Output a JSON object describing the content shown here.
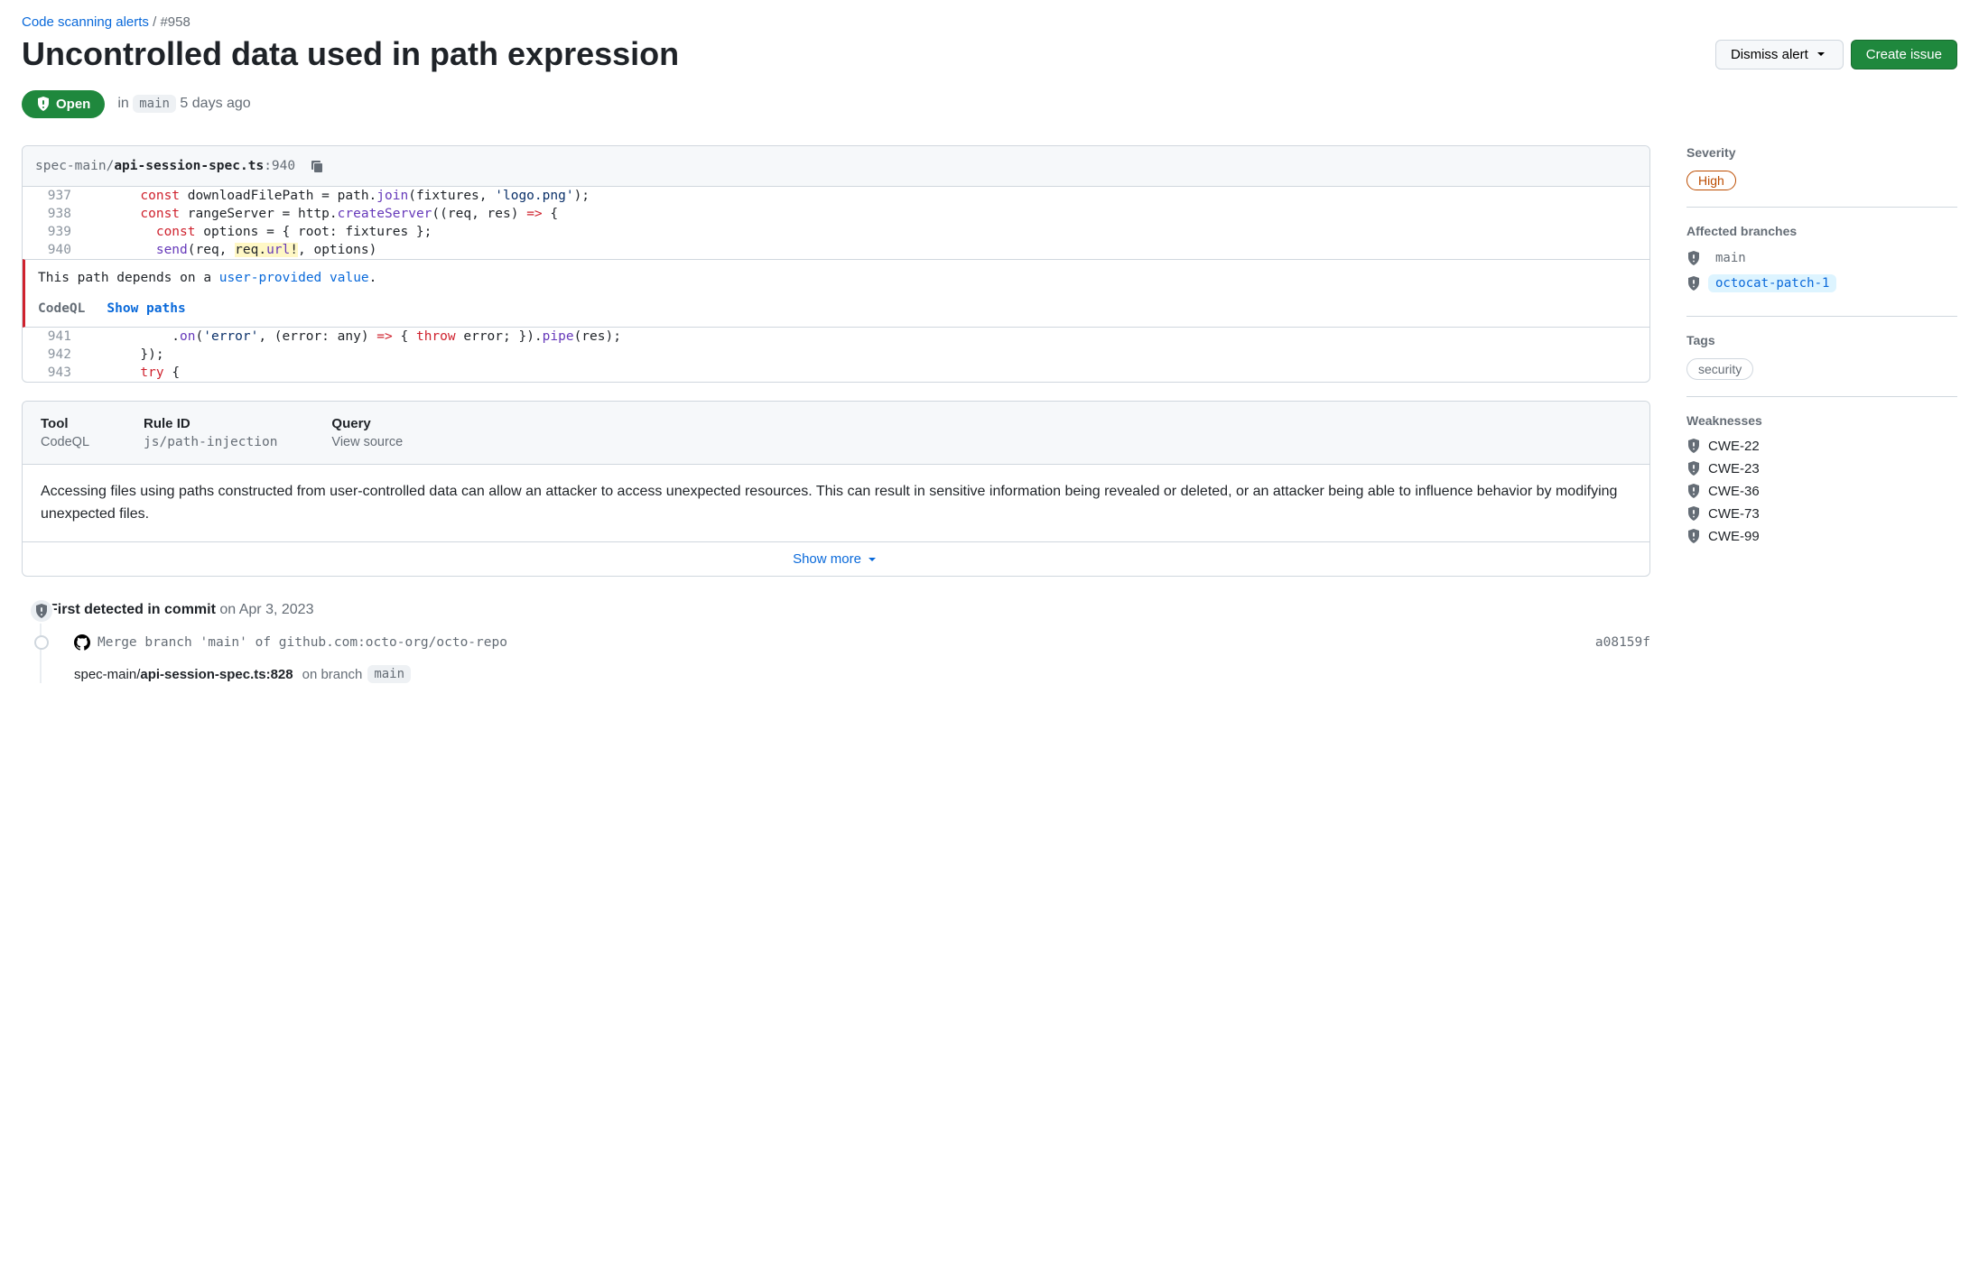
{
  "breadcrumb": {
    "parent": "Code scanning alerts",
    "sep": "/",
    "id": "#958"
  },
  "title": "Uncontrolled data used in path expression",
  "header": {
    "dismiss_label": "Dismiss alert",
    "create_issue_label": "Create issue"
  },
  "status": {
    "state": "Open",
    "in": "in",
    "branch": "main",
    "age": "5 days ago"
  },
  "code": {
    "path_dir": "spec-main/",
    "path_file": "api-session-spec.ts",
    "line_sep": ":",
    "line_no": "940",
    "alert_msg_prefix": "This path depends on a ",
    "alert_msg_link": "user-provided value",
    "alert_msg_suffix": ".",
    "codeql_label": "CodeQL",
    "show_paths_label": "Show paths",
    "lines_top": [
      {
        "n": "937",
        "html": "      <span class=\"tok-kw\">const</span> downloadFilePath = path.<span class=\"tok-fn\">join</span>(fixtures, <span class=\"tok-str\">'logo.png'</span>);"
      },
      {
        "n": "938",
        "html": "      <span class=\"tok-kw\">const</span> rangeServer = http.<span class=\"tok-fn\">createServer</span>((req, res) <span class=\"tok-kw\">=&gt;</span> {"
      },
      {
        "n": "939",
        "html": "        <span class=\"tok-kw\">const</span> options = { root: fixtures };"
      },
      {
        "n": "940",
        "html": "        <span class=\"tok-fn\">send</span>(req, <span class=\"tok-hl\">req.<span class=\"tok-fn\">url</span>!</span>, options)"
      }
    ],
    "lines_bot": [
      {
        "n": "941",
        "html": "          .<span class=\"tok-fn\">on</span>(<span class=\"tok-str\">'error'</span>, (error: any) <span class=\"tok-kw\">=&gt;</span> { <span class=\"tok-kw\">throw</span> error; }).<span class=\"tok-fn\">pipe</span>(res);"
      },
      {
        "n": "942",
        "html": "      });"
      },
      {
        "n": "943",
        "html": "      <span class=\"tok-kw\">try</span> {"
      }
    ]
  },
  "rule": {
    "tool_label": "Tool",
    "tool_value": "CodeQL",
    "ruleid_label": "Rule ID",
    "ruleid_value": "js/path-injection",
    "query_label": "Query",
    "query_value": "View source",
    "description": "Accessing files using paths constructed from user-controlled data can allow an attacker to access unexpected resources. This can result in sensitive information being revealed or deleted, or an attacker being able to influence behavior by modifying unexpected files.",
    "show_more": "Show more"
  },
  "timeline": {
    "detected_label": "First detected in commit",
    "detected_on": "on Apr 3, 2023",
    "commit_msg": "Merge branch 'main' of github.com:octo-org/octo-repo",
    "commit_sha": "a08159f",
    "path_dir": "spec-main/",
    "path_file": "api-session-spec.ts:828",
    "on_branch": "on branch",
    "branch": "main"
  },
  "sidebar": {
    "severity_label": "Severity",
    "severity_value": "High",
    "affected_label": "Affected branches",
    "branches": [
      {
        "name": "main",
        "active": false
      },
      {
        "name": "octocat-patch-1",
        "active": true
      }
    ],
    "tags_label": "Tags",
    "tags": [
      "security"
    ],
    "weak_label": "Weaknesses",
    "weaknesses": [
      "CWE-22",
      "CWE-23",
      "CWE-36",
      "CWE-73",
      "CWE-99"
    ]
  }
}
